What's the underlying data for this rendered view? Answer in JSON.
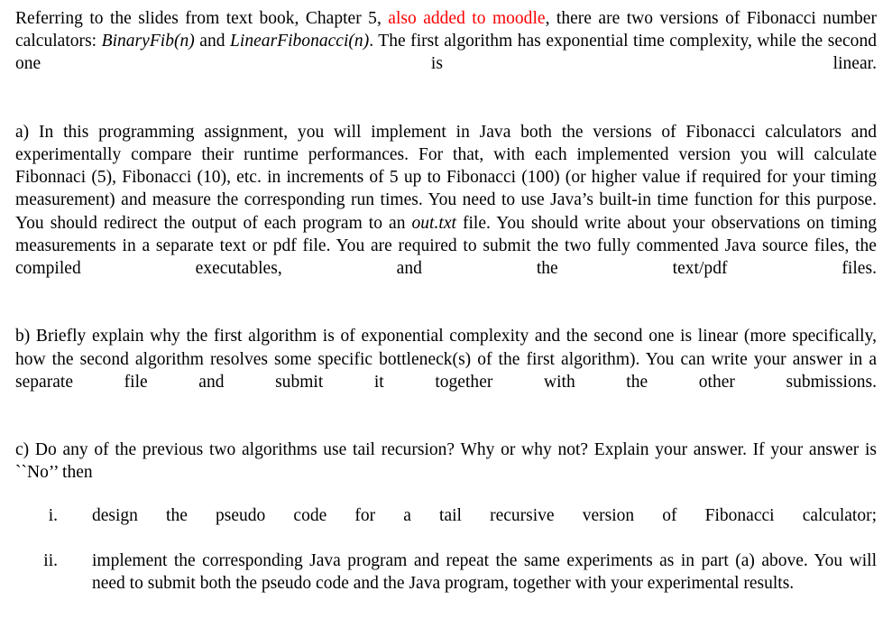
{
  "document": {
    "background_color": "#ffffff",
    "text_color": "#000000",
    "accent_color": "#ff0000",
    "paragraphs": {
      "intro": {
        "part1": "Referring to the slides from text book, Chapter 5, ",
        "highlight": "also added to moodle",
        "part2": ", there are two versions of Fibonacci number calculators: ",
        "italic1": "BinaryFib(n)",
        "part3": " and ",
        "italic2": "LinearFibonacci(n)",
        "part4": ". The first algorithm has exponential time complexity, while the second one is linear."
      },
      "part_a": {
        "part1": "a) In this programming assignment, you will implement in Java both the versions of Fibonacci calculators and experimentally compare their runtime performances. For that, with each implemented version you will calculate Fibonnaci (5), Fibonacci (10), etc. in increments of 5 up to Fibonacci (100) (or higher value if required for your timing measurement) and measure the corresponding run times. You need to use Java’s built-in time function for this purpose. You should redirect the output of each program to an ",
        "italic1": "out.txt",
        "part2": " file. You should write about your observations on timing measurements in a separate text or pdf file. You are required to submit the two fully commented Java source files, the compiled executables, and the text/pdf files."
      },
      "part_b": {
        "text": "b) Briefly explain why the first algorithm is of exponential complexity and the second one is linear (more specifically, how the second algorithm resolves some specific bottleneck(s) of the first algorithm). You can write your answer in a separate file and submit it together with the other submissions."
      },
      "part_c": {
        "text": "c) Do any of the previous two algorithms use tail recursion? Why or why not? Explain your answer. If your answer is ``No’’ then"
      }
    },
    "sub_list": [
      {
        "marker": "i.",
        "text": "design the pseudo code for a tail recursive version of Fibonacci calculator;"
      },
      {
        "marker": "ii.",
        "text": "implement the corresponding Java program and repeat the same experiments as in part (a) above. You will need to submit both the pseudo code and the Java program, together with your experimental results."
      }
    ]
  }
}
